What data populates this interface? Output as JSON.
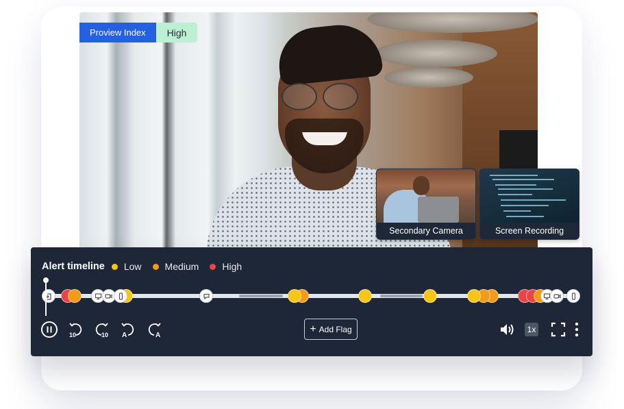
{
  "proview_index": {
    "label": "Proview Index",
    "value": "High",
    "label_color": "#2560e0",
    "value_color": "#bdf0d2"
  },
  "thumbnails": [
    {
      "caption": "Secondary Camera"
    },
    {
      "caption": "Screen Recording"
    }
  ],
  "timeline": {
    "title": "Alert timeline",
    "legend": [
      {
        "label": "Low",
        "color": "#f5c518"
      },
      {
        "label": "Medium",
        "color": "#f29a1a"
      },
      {
        "label": "High",
        "color": "#e84545"
      }
    ],
    "playhead_position_pct": 0,
    "markers": [
      {
        "type": "event",
        "icon": "exit-icon",
        "pos_pct": 0.5
      },
      {
        "type": "alert",
        "severity": "High",
        "pos_pct": 4.2
      },
      {
        "type": "alert",
        "severity": "Medium",
        "pos_pct": 5.4
      },
      {
        "type": "event",
        "icon": "monitor-icon",
        "pos_pct": 9.9
      },
      {
        "type": "event",
        "icon": "video-camera-icon",
        "pos_pct": 11.9
      },
      {
        "type": "alert",
        "severity": "Low",
        "pos_pct": 15.2
      },
      {
        "type": "event",
        "icon": "mobile-phone-icon",
        "pos_pct": 14.2
      },
      {
        "type": "event",
        "icon": "chat-icon",
        "pos_pct": 30.4
      },
      {
        "type": "alert",
        "severity": "Medium",
        "pos_pct": 48.6
      },
      {
        "type": "alert",
        "severity": "Low",
        "pos_pct": 47.2
      },
      {
        "type": "alert",
        "severity": "Low",
        "pos_pct": 60.5
      },
      {
        "type": "alert",
        "severity": "Low",
        "pos_pct": 72.8
      },
      {
        "type": "alert",
        "severity": "Medium",
        "pos_pct": 84.6
      },
      {
        "type": "alert",
        "severity": "Medium",
        "pos_pct": 83.0
      },
      {
        "type": "alert",
        "severity": "Low",
        "pos_pct": 81.2
      },
      {
        "type": "alert",
        "severity": "High",
        "pos_pct": 90.8
      },
      {
        "type": "alert",
        "severity": "High",
        "pos_pct": 92.4
      },
      {
        "type": "alert",
        "severity": "Medium",
        "pos_pct": 93.8
      },
      {
        "type": "event",
        "icon": "monitor-icon",
        "pos_pct": 95.0
      },
      {
        "type": "event",
        "icon": "video-camera-icon",
        "pos_pct": 96.9
      },
      {
        "type": "event",
        "icon": "mobile-phone-icon",
        "pos_pct": 100
      }
    ],
    "gap_segments": [
      {
        "start_pct": 36.6,
        "end_pct": 45.0
      },
      {
        "start_pct": 63.4,
        "end_pct": 71.4
      }
    ]
  },
  "controls": {
    "pause_icon": "pause-icon",
    "rewind_10_label": "10",
    "forward_10_label": "10",
    "prev_alert_label": "A",
    "next_alert_label": "A",
    "add_flag_label": "Add Flag",
    "speed_label": "1x"
  }
}
